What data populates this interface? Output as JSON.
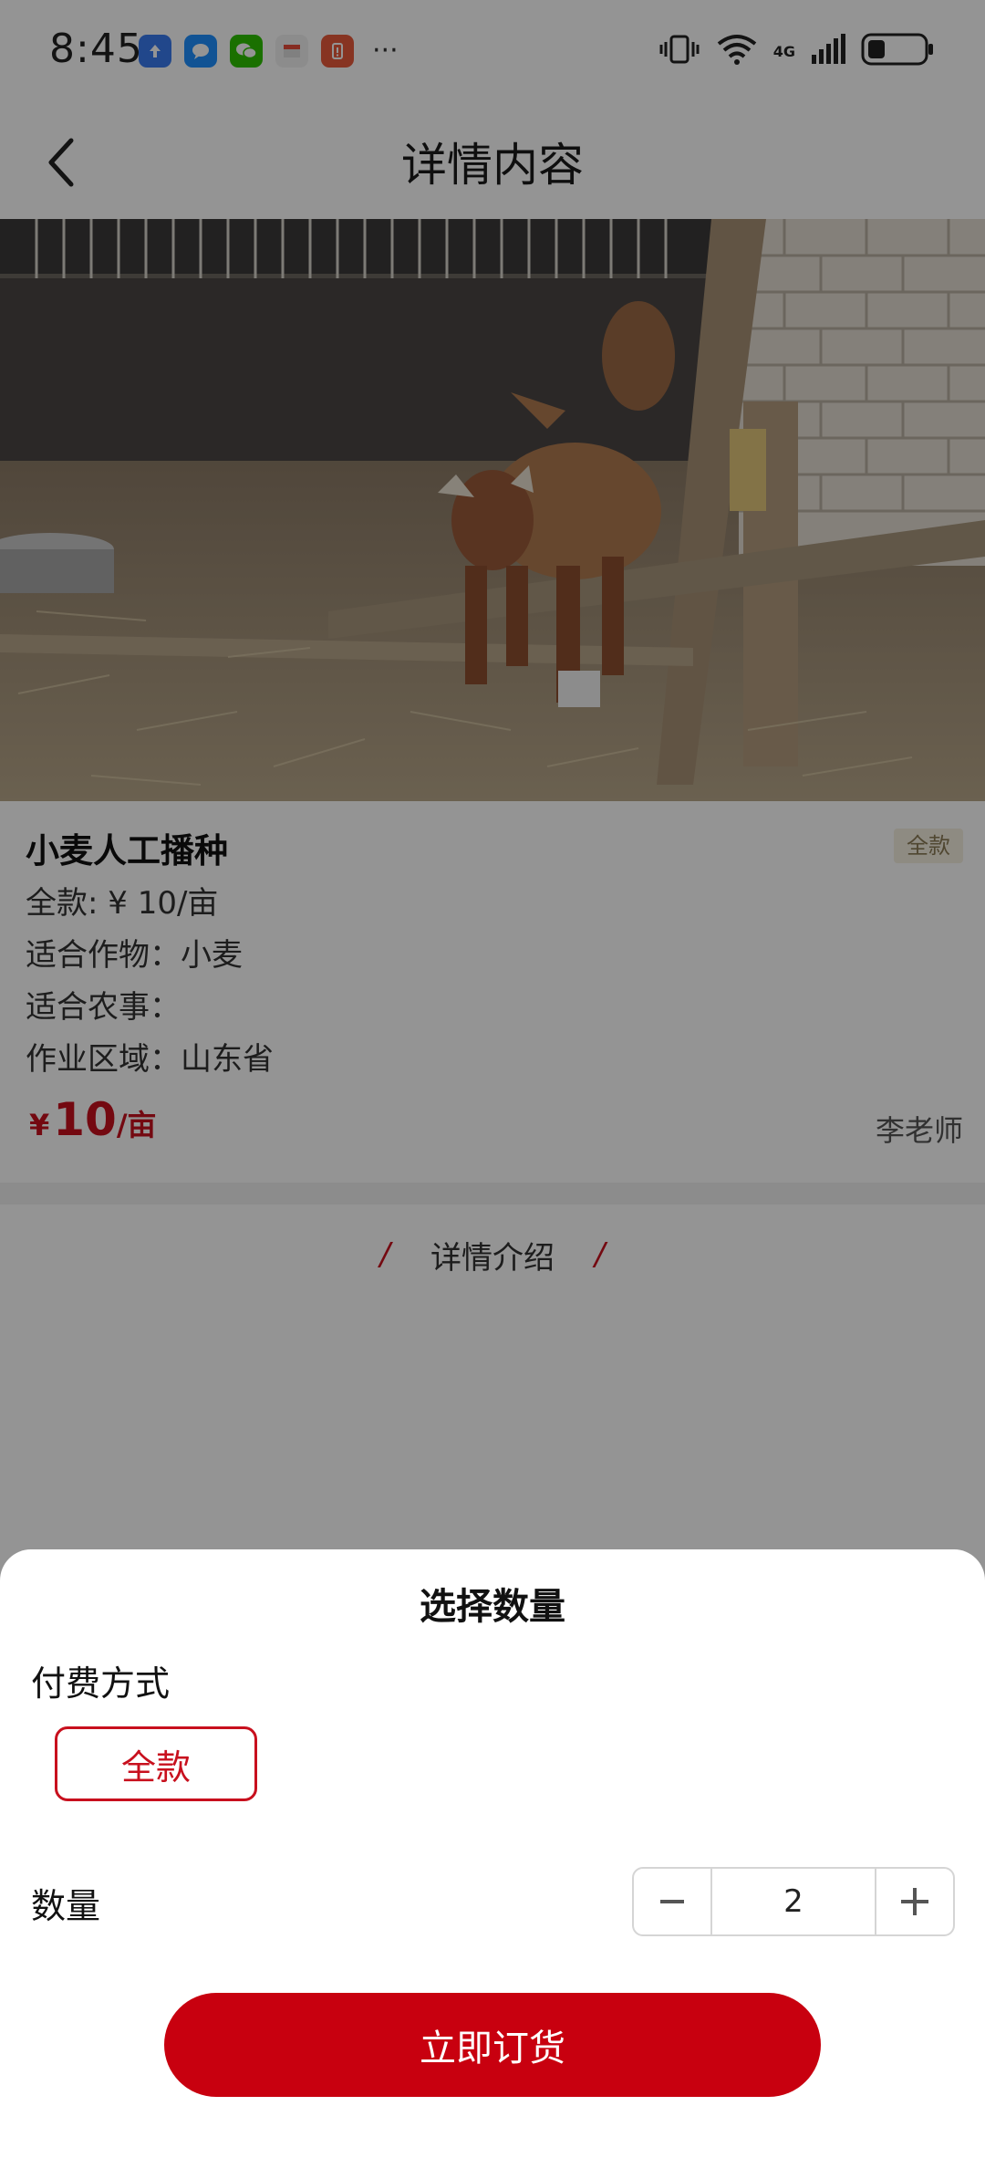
{
  "status_bar": {
    "time": "8:45",
    "apps": [
      {
        "icon": "upload-app-icon",
        "color": "#3a7bf0"
      },
      {
        "icon": "message-app-icon",
        "color": "#1e90ff"
      },
      {
        "icon": "wechat-icon",
        "color": "#2dc100"
      },
      {
        "icon": "box-app-icon",
        "color": "#f2f2f2"
      },
      {
        "icon": "alert-app-icon",
        "color": "#e85a3c"
      }
    ],
    "more": "···",
    "network": "4G"
  },
  "nav": {
    "title": "详情内容"
  },
  "product": {
    "title": "小麦人工播种",
    "tag": "全款",
    "price_line": "全款: ¥ 10/亩",
    "crop_line": "适合作物：小麦",
    "farm_line": "适合农事：",
    "area_line": "作业区域：山东省",
    "price_symbol": "¥",
    "price_value": "10",
    "price_unit": "/亩",
    "seller": "李老师"
  },
  "detail": {
    "label": "详情介绍",
    "slash": "/"
  },
  "sheet": {
    "title": "选择数量",
    "payment_label": "付费方式",
    "payment_option": "全款",
    "quantity_label": "数量",
    "minus": "−",
    "quantity": "2",
    "plus": "+",
    "order_button": "立即订货"
  },
  "colors": {
    "accent": "#c8101e",
    "button": "#c8000f"
  }
}
